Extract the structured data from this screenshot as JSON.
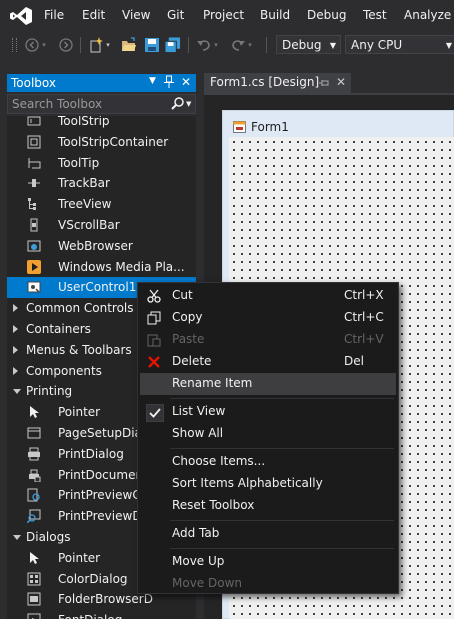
{
  "menu": {
    "items": [
      "File",
      "Edit",
      "View",
      "Git",
      "Project",
      "Build",
      "Debug",
      "Test",
      "Analyze"
    ]
  },
  "toolbar": {
    "config_value": "Debug",
    "platform_value": "Any CPU"
  },
  "toolbox": {
    "title": "Toolbox",
    "search_placeholder": "Search Toolbox",
    "rows": [
      {
        "type": "item",
        "label": "ToolStrip",
        "icon": "toolstrip-icon"
      },
      {
        "type": "item",
        "label": "ToolStripContainer",
        "icon": "toolstripcontainer-icon"
      },
      {
        "type": "item",
        "label": "ToolTip",
        "icon": "tooltip-icon"
      },
      {
        "type": "item",
        "label": "TrackBar",
        "icon": "trackbar-icon"
      },
      {
        "type": "item",
        "label": "TreeView",
        "icon": "treeview-icon"
      },
      {
        "type": "item",
        "label": "VScrollBar",
        "icon": "vscrollbar-icon"
      },
      {
        "type": "item",
        "label": "WebBrowser",
        "icon": "webbrowser-icon"
      },
      {
        "type": "item",
        "label": "Windows Media Pla...",
        "icon": "media-player-icon"
      },
      {
        "type": "item",
        "label": "UserControl1",
        "icon": "usercontrol-icon",
        "selected": true
      },
      {
        "type": "cat",
        "label": "Common Controls",
        "expanded": false
      },
      {
        "type": "cat",
        "label": "Containers",
        "expanded": false
      },
      {
        "type": "cat",
        "label": "Menus & Toolbars",
        "expanded": false
      },
      {
        "type": "cat",
        "label": "Components",
        "expanded": false
      },
      {
        "type": "cat",
        "label": "Printing",
        "expanded": true
      },
      {
        "type": "item",
        "label": "Pointer",
        "icon": "pointer-icon"
      },
      {
        "type": "item",
        "label": "PageSetupDial",
        "icon": "pagesetup-icon"
      },
      {
        "type": "item",
        "label": "PrintDialog",
        "icon": "printdialog-icon"
      },
      {
        "type": "item",
        "label": "PrintDocumen",
        "icon": "printdocument-icon"
      },
      {
        "type": "item",
        "label": "PrintPreviewCo",
        "icon": "printpreviewcontrol-icon"
      },
      {
        "type": "item",
        "label": "PrintPreviewDi",
        "icon": "printpreviewdialog-icon"
      },
      {
        "type": "cat",
        "label": "Dialogs",
        "expanded": true
      },
      {
        "type": "item",
        "label": "Pointer",
        "icon": "pointer-icon"
      },
      {
        "type": "item",
        "label": "ColorDialog",
        "icon": "colordialog-icon"
      },
      {
        "type": "item",
        "label": "FolderBrowserD",
        "icon": "folderbrowser-icon"
      },
      {
        "type": "item",
        "label": "FontDialog",
        "icon": "fontdialog-icon"
      }
    ]
  },
  "document": {
    "tab_label": "Form1.cs [Design]",
    "form_title": "Form1"
  },
  "context_menu": {
    "items": [
      {
        "label": "Cut",
        "shortcut": "Ctrl+X",
        "icon": "cut-icon"
      },
      {
        "label": "Copy",
        "shortcut": "Ctrl+C",
        "icon": "copy-icon"
      },
      {
        "label": "Paste",
        "shortcut": "Ctrl+V",
        "icon": "paste-icon",
        "disabled": true
      },
      {
        "label": "Delete",
        "shortcut": "Del",
        "icon": "delete-icon"
      },
      {
        "label": "Rename Item",
        "shortcut": "",
        "highlighted": true
      },
      {
        "sep": true
      },
      {
        "label": "List View",
        "shortcut": "",
        "icon": "checkmark-icon",
        "checked": true
      },
      {
        "label": "Show All",
        "shortcut": ""
      },
      {
        "sep": true
      },
      {
        "label": "Choose Items...",
        "shortcut": ""
      },
      {
        "label": "Sort Items Alphabetically",
        "shortcut": ""
      },
      {
        "label": "Reset Toolbox",
        "shortcut": ""
      },
      {
        "sep": true
      },
      {
        "label": "Add Tab",
        "shortcut": ""
      },
      {
        "sep": true
      },
      {
        "label": "Move Up",
        "shortcut": ""
      },
      {
        "label": "Move Down",
        "shortcut": "",
        "disabled": true
      }
    ]
  },
  "colors": {
    "accent": "#007acc",
    "background": "#2d2d30",
    "delete_red": "#e51400"
  }
}
